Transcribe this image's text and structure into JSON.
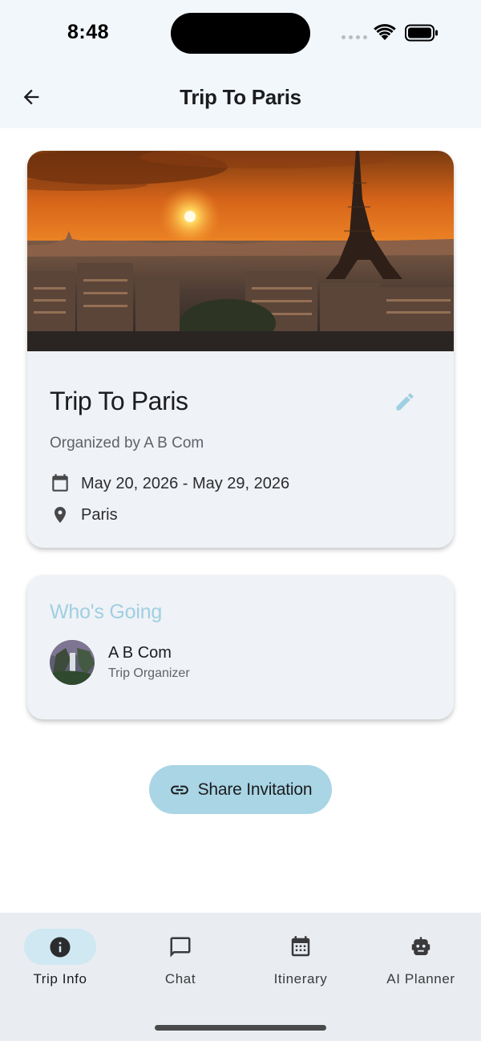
{
  "status_bar": {
    "time": "8:48"
  },
  "app_bar": {
    "title": "Trip To Paris"
  },
  "trip": {
    "name": "Trip To Paris",
    "organizer": "Organized by A B Com",
    "dates": "May 20, 2026 - May 29, 2026",
    "location": "Paris"
  },
  "going": {
    "title": "Who's Going",
    "members": [
      {
        "name": "A B Com",
        "role": "Trip Organizer"
      }
    ]
  },
  "share": {
    "label": "Share Invitation"
  },
  "nav": {
    "items": [
      {
        "label": "Trip Info",
        "icon": "info-icon",
        "active": true
      },
      {
        "label": "Chat",
        "icon": "chat-icon",
        "active": false
      },
      {
        "label": "Itinerary",
        "icon": "calendar-icon",
        "active": false
      },
      {
        "label": "AI Planner",
        "icon": "robot-icon",
        "active": false
      }
    ]
  },
  "colors": {
    "accent": "#9fcfe2",
    "button": "#a9d5e5",
    "card": "#eff2f6",
    "header_bg": "#f1f7fb",
    "nav_bg": "#e9edf1",
    "nav_active": "#cfe8f2"
  }
}
